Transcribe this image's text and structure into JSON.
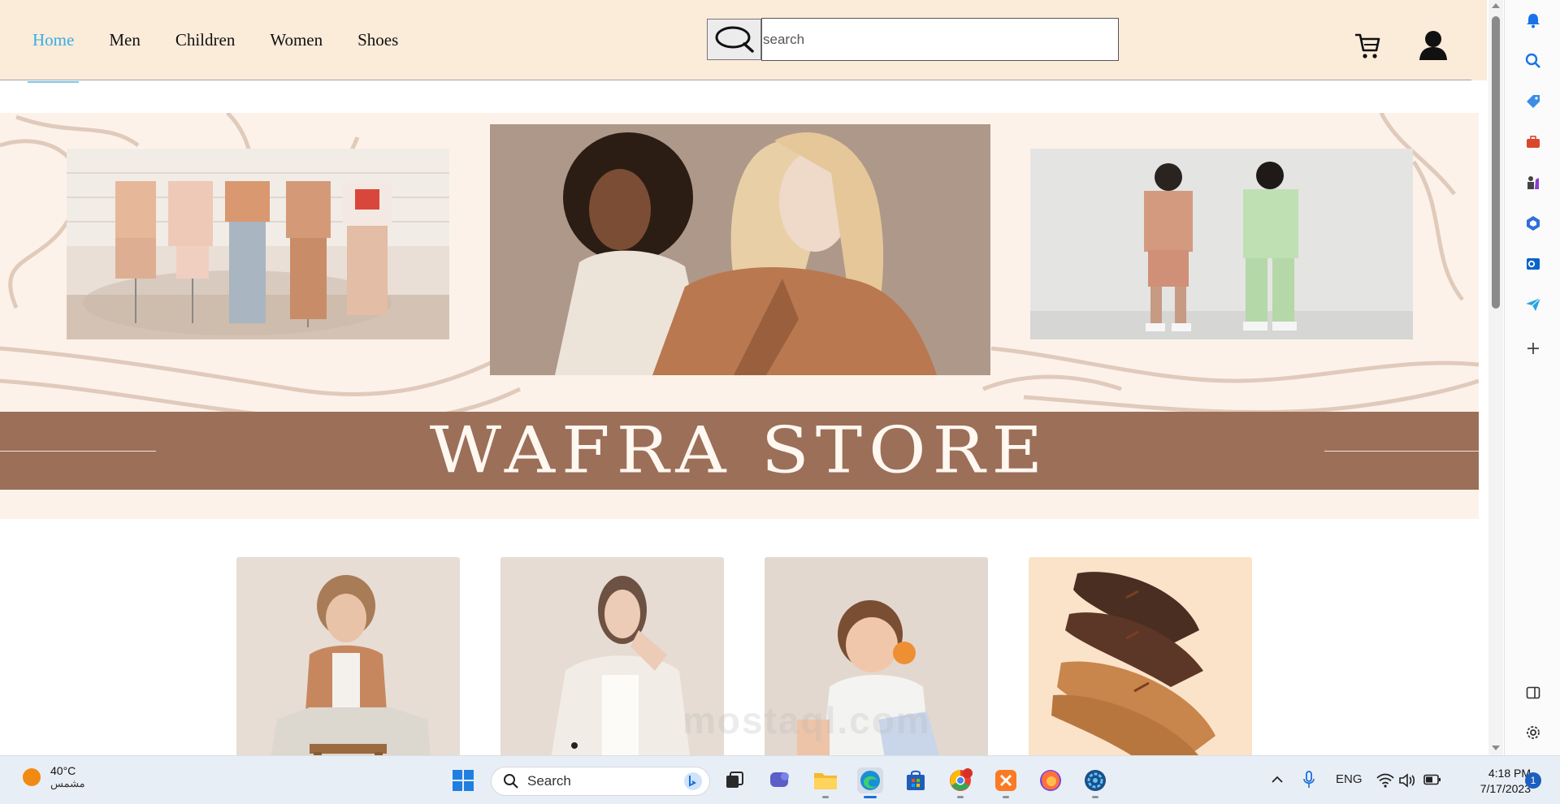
{
  "header": {
    "nav": [
      {
        "label": "Home",
        "active": true
      },
      {
        "label": "Men"
      },
      {
        "label": "Children"
      },
      {
        "label": "Women"
      },
      {
        "label": "Shoes"
      }
    ],
    "search_placeholder": "search"
  },
  "hero": {
    "banner_title": "WAFRA STORE"
  },
  "products": [
    {
      "icon": "man-on-stool-photo"
    },
    {
      "icon": "woman-in-white-blazer-photo"
    },
    {
      "icon": "smiling-boy-photo"
    },
    {
      "icon": "boat-shoes-photo"
    }
  ],
  "taskbar": {
    "weather_temp": "40°C",
    "weather_desc": "مشمس",
    "search_label": "Search",
    "language": "ENG",
    "time": "4:18 PM",
    "date": "7/17/2023",
    "notification_count": "1"
  },
  "colors": {
    "header_bg": "#fbebd9",
    "active_nav": "#36aee6",
    "banner_bg": "#9c6f59",
    "hero_bg": "#fdf2ea"
  }
}
